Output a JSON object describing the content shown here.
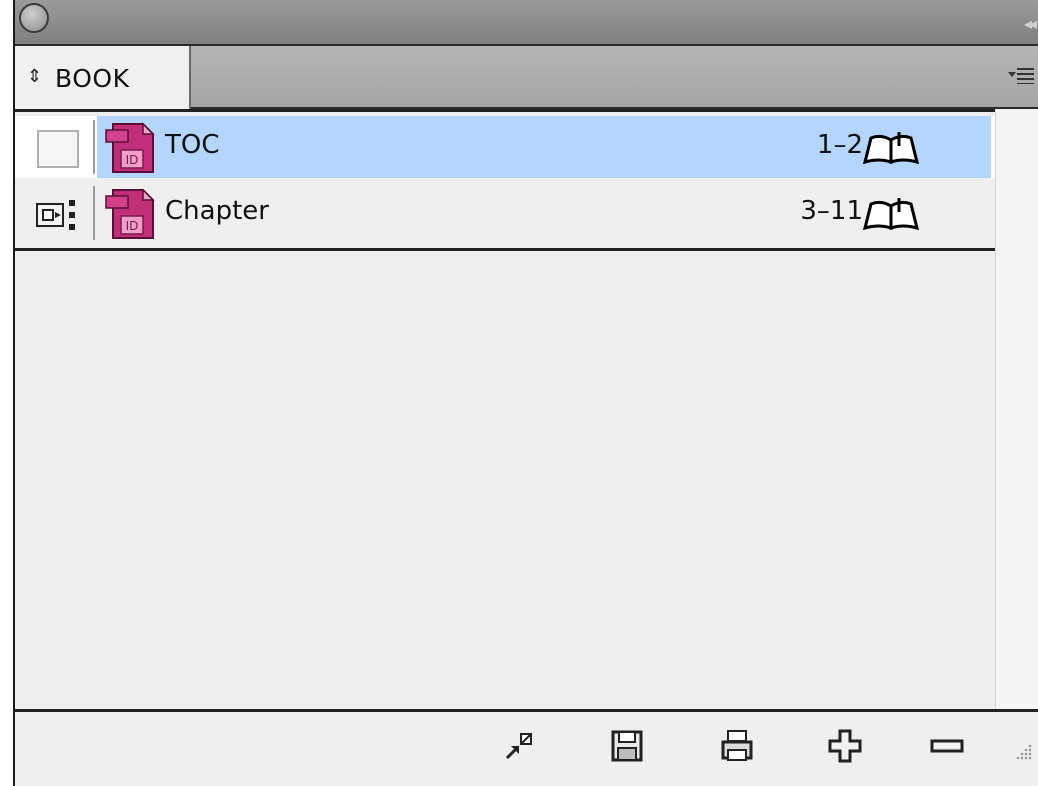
{
  "panel": {
    "tab_label": "BOOK",
    "tab_arrows": "⇕"
  },
  "documents": [
    {
      "name": "TOC",
      "pages": "1–2",
      "selected": true,
      "status": "empty",
      "icon": "indesign-doc-icon"
    },
    {
      "name": "Chapter",
      "pages": "3–11",
      "selected": false,
      "status": "style-source",
      "icon": "indesign-doc-icon"
    }
  ],
  "toolbar": {
    "icons": [
      "synchronize-icon",
      "save-book-icon",
      "print-book-icon",
      "add-document-icon",
      "remove-document-icon"
    ]
  },
  "colors": {
    "selection": "#b4d5fe",
    "indesign_icon": "#b0246a"
  }
}
